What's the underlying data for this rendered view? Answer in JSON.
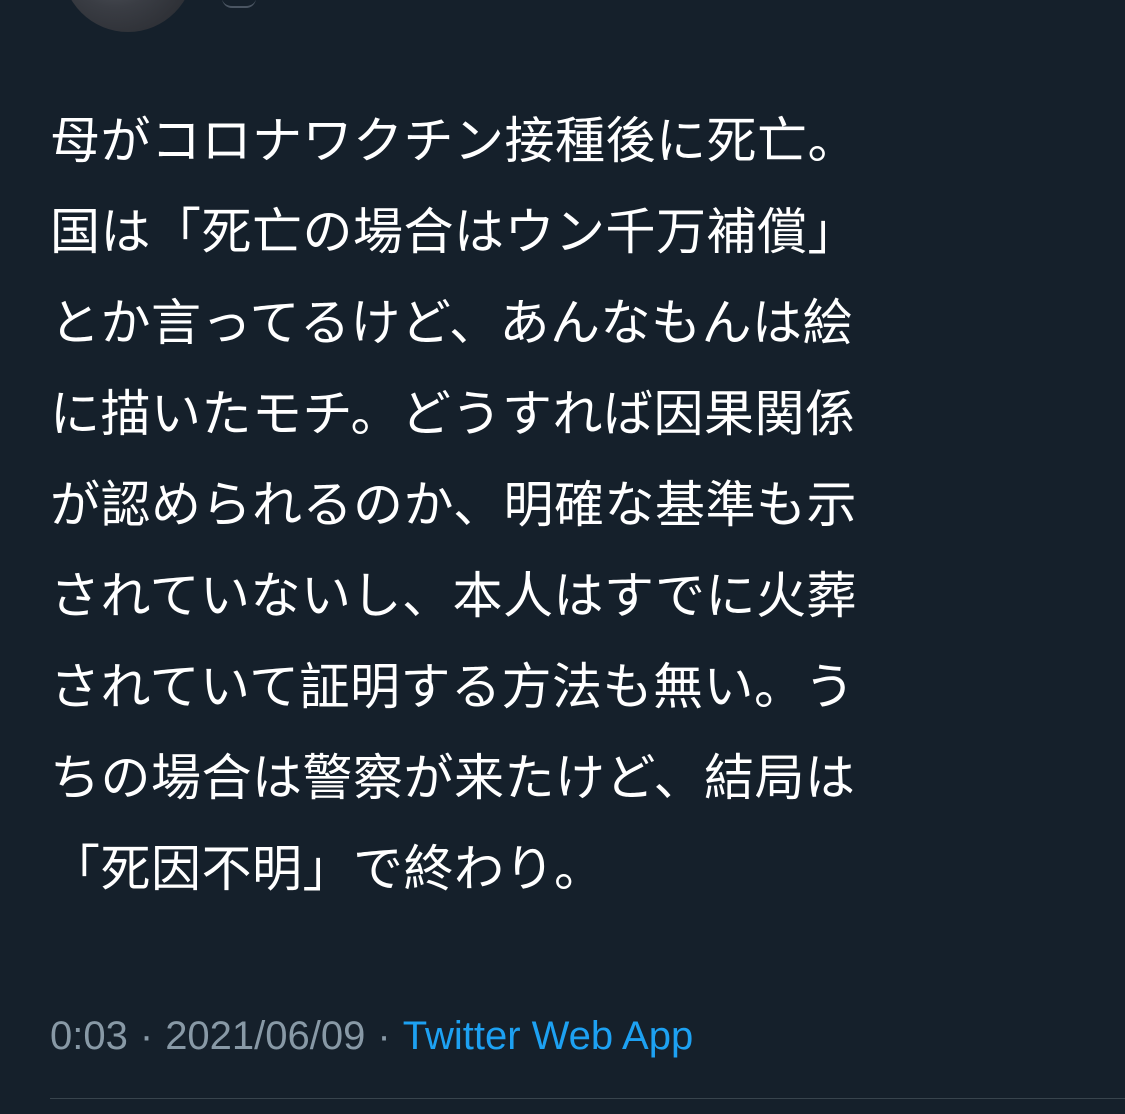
{
  "tweet": {
    "lines": [
      "母がコロナワクチン接種後に死亡。",
      "国は「死亡の場合はウン千万補償」",
      "とか言ってるけど、あんなもんは絵",
      "に描いたモチ。どうすれば因果関係",
      "が認められるのか、明確な基準も示",
      "されていないし、本人はすでに火葬",
      "されていて証明する方法も無い。う",
      "ちの場合は警察が来たけど、結局は",
      "「死因不明」で終わり。"
    ]
  },
  "meta": {
    "time": "0:03",
    "separator": "·",
    "date": "2021/06/09",
    "source": "Twitter Web App"
  },
  "colors": {
    "background": "#15202b",
    "text": "#ffffff",
    "muted": "#8899a6",
    "link": "#1da1f2"
  },
  "icons": {
    "avatar": "user-avatar-image"
  }
}
